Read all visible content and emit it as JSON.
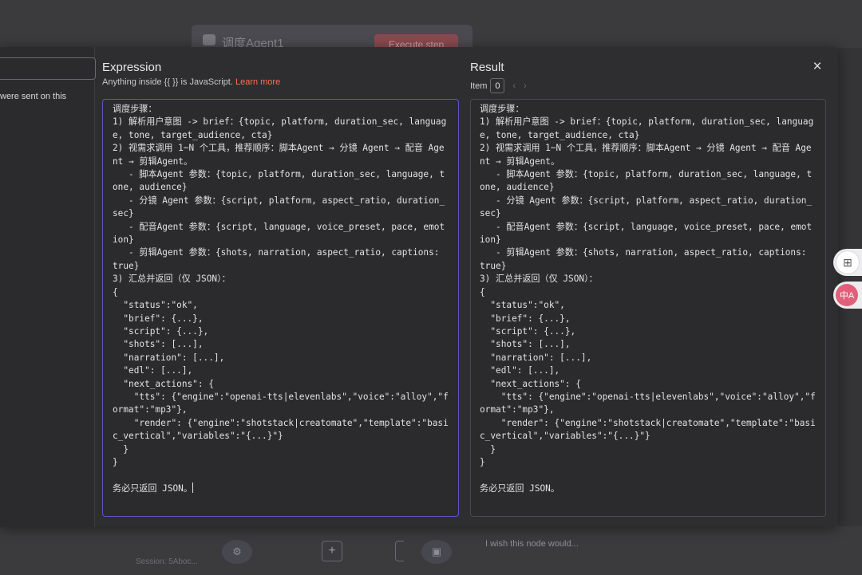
{
  "background": {
    "node_title": "调度Agent1",
    "execute_label": "Execute step",
    "left_text": "were sent on this",
    "wish_text": "I wish this node would...",
    "session_text": "Session: 5Aboc...",
    "add_label": "+"
  },
  "expression": {
    "title": "Expression",
    "hint_prefix": "Anything inside {{ }} is JavaScript.",
    "learn_more": "Learn more",
    "code": "调度步骤：\n1) 解析用户意图 -> brief：{topic, platform, duration_sec, language, tone, target_audience, cta}\n2) 视需求调用 1~N 个工具，推荐顺序：脚本Agent → 分镜 Agent → 配音 Agent → 剪辑Agent。\n   - 脚本Agent 参数：{topic, platform, duration_sec, language, tone, audience}\n   - 分镜 Agent 参数：{script, platform, aspect_ratio, duration_sec}\n   - 配音Agent 参数：{script, language, voice_preset, pace, emotion}\n   - 剪辑Agent 参数：{shots, narration, aspect_ratio, captions: true}\n3) 汇总并返回（仅 JSON）：\n{\n  \"status\":\"ok\",\n  \"brief\": {...},\n  \"script\": {...},\n  \"shots\": [...],\n  \"narration\": [...],\n  \"edl\": [...],\n  \"next_actions\": {\n    \"tts\": {\"engine\":\"openai-tts|elevenlabs\",\"voice\":\"alloy\",\"format\":\"mp3\"},\n    \"render\": {\"engine\":\"shotstack|creatomate\",\"template\":\"basic_vertical\",\"variables\":\"{...}\"}\n  }\n}\n\n务必只返回 JSON。"
  },
  "result": {
    "title": "Result",
    "item_label": "Item",
    "item_value": "0",
    "prev_arrow": "‹",
    "next_arrow": "›",
    "code": "调度步骤：\n1) 解析用户意图 -> brief：{topic, platform, duration_sec, language, tone, target_audience, cta}\n2) 视需求调用 1~N 个工具，推荐顺序：脚本Agent → 分镜 Agent → 配音 Agent → 剪辑Agent。\n   - 脚本Agent 参数：{topic, platform, duration_sec, language, tone, audience}\n   - 分镜 Agent 参数：{script, platform, aspect_ratio, duration_sec}\n   - 配音Agent 参数：{script, language, voice_preset, pace, emotion}\n   - 剪辑Agent 参数：{shots, narration, aspect_ratio, captions: true}\n3) 汇总并返回（仅 JSON）：\n{\n  \"status\":\"ok\",\n  \"brief\": {...},\n  \"script\": {...},\n  \"shots\": [...],\n  \"narration\": [...],\n  \"edl\": [...],\n  \"next_actions\": {\n    \"tts\": {\"engine\":\"openai-tts|elevenlabs\",\"voice\":\"alloy\",\"format\":\"mp3\"},\n    \"render\": {\"engine\":\"shotstack|creatomate\",\"template\":\"basic_vertical\",\"variables\":\"{...}\"}\n  }\n}\n\n务必只返回 JSON。"
  },
  "close_label": "×",
  "widgets": {
    "apps_icon": "apps-icon",
    "translate_icon": "translate-icon",
    "translate_text": "中A"
  },
  "colors": {
    "accent_link": "#ff6d5a",
    "editor_border": "#5b56c8"
  }
}
